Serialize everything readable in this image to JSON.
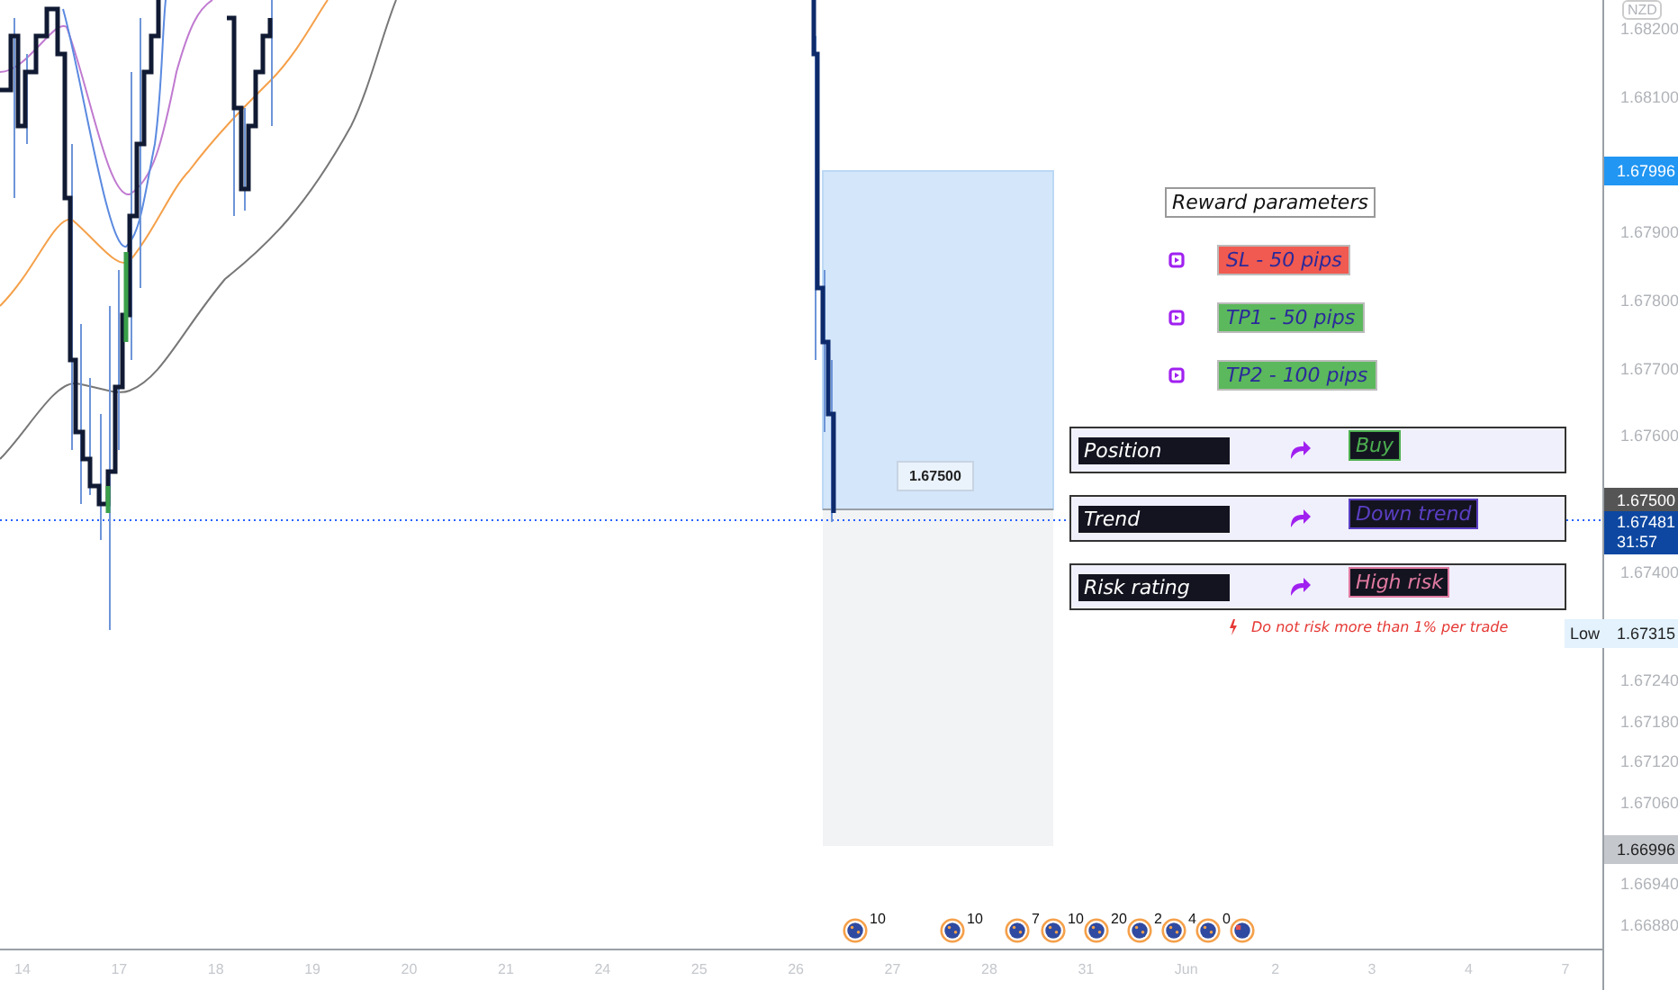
{
  "price_axis": {
    "currency": "NZD",
    "ticks": [
      "1.68200",
      "1.68100",
      "1.67900",
      "1.67800",
      "1.67700",
      "1.67600",
      "1.67400",
      "1.67240",
      "1.67180",
      "1.67120",
      "1.67060",
      "1.66940",
      "1.66880"
    ],
    "labels": [
      {
        "kind": "target",
        "text": "1.67996"
      },
      {
        "kind": "entry",
        "text": "1.67500"
      },
      {
        "kind": "last",
        "text": "1.67481",
        "countdown": "31:57"
      },
      {
        "kind": "low",
        "tag": "Low",
        "text": "1.67315"
      },
      {
        "kind": "stop",
        "text": "1.66996"
      }
    ]
  },
  "time_axis": {
    "labels": [
      "14",
      "17",
      "18",
      "19",
      "20",
      "21",
      "24",
      "25",
      "26",
      "27",
      "28",
      "31",
      "Jun",
      "2",
      "3",
      "4",
      "7"
    ]
  },
  "events": [
    {
      "kind": "globe",
      "count": "10"
    },
    {
      "kind": "globe",
      "count": "10"
    },
    {
      "kind": "globe",
      "count": "7"
    },
    {
      "kind": "globe",
      "count": "10"
    },
    {
      "kind": "globe",
      "count": "20"
    },
    {
      "kind": "globe",
      "count": "2"
    },
    {
      "kind": "globe",
      "count": "4"
    },
    {
      "kind": "globe",
      "count": "0"
    },
    {
      "kind": "flag"
    }
  ],
  "position_tool": {
    "entry_label": "1.67500"
  },
  "annotations": {
    "title": "Reward parameters",
    "targets": [
      {
        "text": "SL - 50 pips",
        "color": "#f05a50"
      },
      {
        "text": "TP1 - 50 pips",
        "color": "#5cb85c"
      },
      {
        "text": "TP2 - 100 pips",
        "color": "#5cb85c"
      }
    ],
    "rows": [
      {
        "label": "Position",
        "value": "Buy",
        "color": "#4caf50"
      },
      {
        "label": "Trend",
        "value": "Down trend",
        "color": "#5b3fc4"
      },
      {
        "label": "Risk rating",
        "value": "High risk",
        "color": "#e07aa0"
      }
    ],
    "warning": "Do not risk more than 1% per trade"
  }
}
